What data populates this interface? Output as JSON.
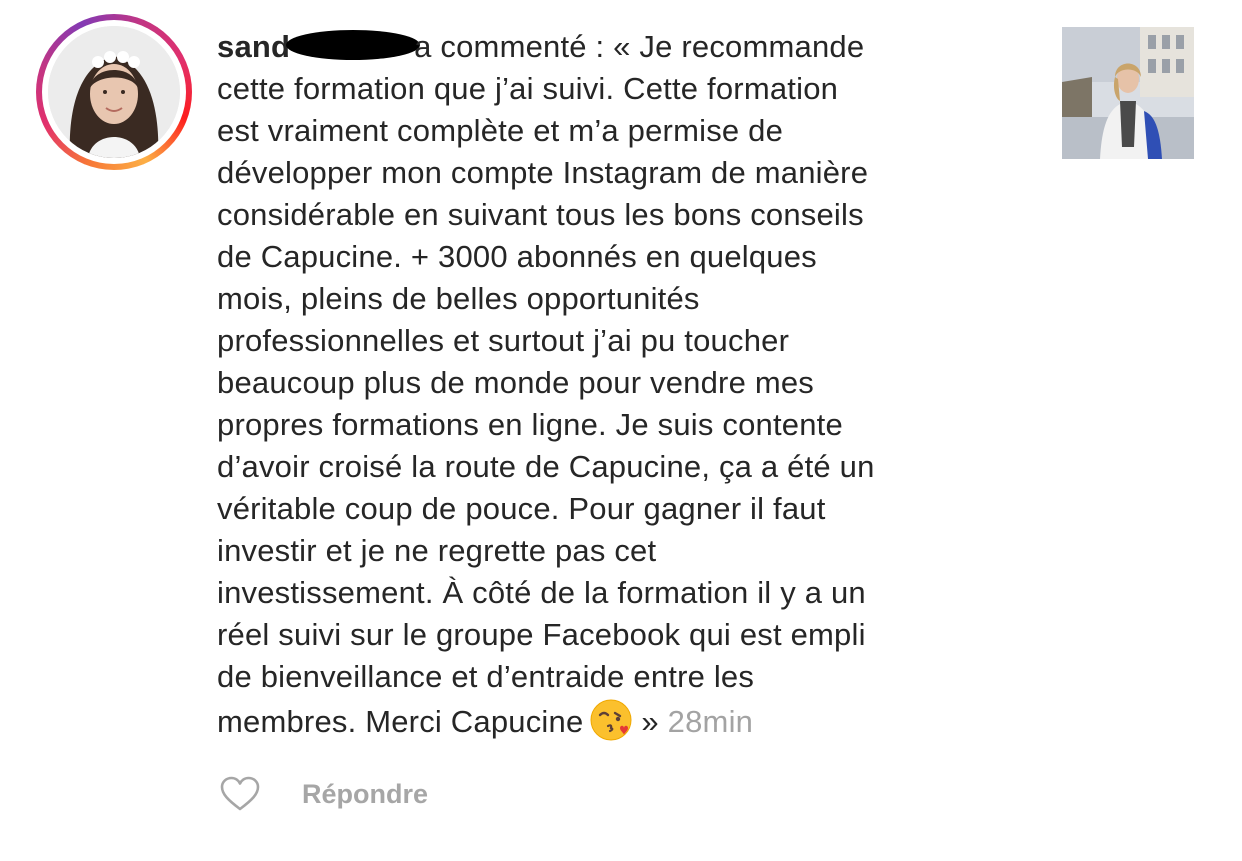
{
  "comment": {
    "username": "sand",
    "lines": [
      "a commenté : « Je recommande",
      "cette formation que j’ai suivi. Cette formation",
      "est vraiment complète et m’a permise de",
      "développer mon compte Instagram de manière",
      "considérable en suivant tous les bons conseils",
      "de Capucine. + 3000 abonnés en quelques",
      "mois, pleins de belles opportunités",
      "professionnelles et surtout j’ai pu toucher",
      "beaucoup plus de monde pour vendre mes",
      "propres formations en ligne. Je suis contente",
      "d’avoir croisé la route de Capucine, ça a été un",
      "véritable coup de pouce. Pour gagner il faut",
      "investir et je ne regrette pas cet",
      "investissement. À côté de la formation il y a un",
      "réel suivi sur le groupe Facebook qui est empli",
      "de bienveillance et d’entraide entre les",
      "membres. Merci Capucine"
    ],
    "closing": "»",
    "timestamp": "28min",
    "emoji": "face-blowing-a-kiss-emoji"
  },
  "actions": {
    "reply_label": "Répondre",
    "like_icon": "heart-outline-icon"
  },
  "colors": {
    "text": "#262626",
    "muted": "#a3a3a3",
    "story_ring_start": "#fcaf45",
    "story_ring_end": "#833ab4"
  }
}
